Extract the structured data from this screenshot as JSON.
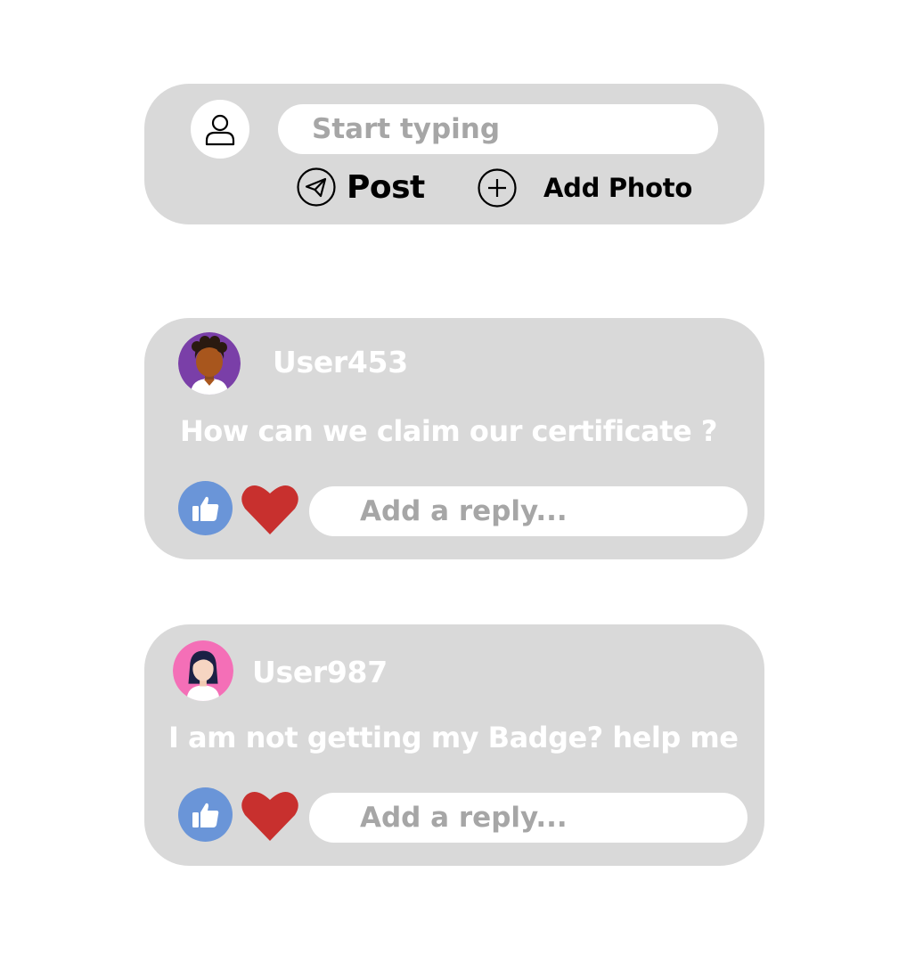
{
  "composer": {
    "placeholder": "Start typing",
    "post_label": "Post",
    "add_photo_label": "Add Photo"
  },
  "posts": [
    {
      "username": "User453",
      "text": "How can we claim our certificate ?",
      "reply_placeholder": "Add a reply...",
      "avatar_color": "#7a3fa8"
    },
    {
      "username": "User987",
      "text": "I am not getting my Badge? help me",
      "reply_placeholder": "Add a reply...",
      "avatar_color": "#f46fb7"
    }
  ],
  "colors": {
    "card_background": "#d9d9d9",
    "like_button": "#6a95d8",
    "heart": "#c8302e",
    "placeholder_text": "#a6a6a6"
  }
}
